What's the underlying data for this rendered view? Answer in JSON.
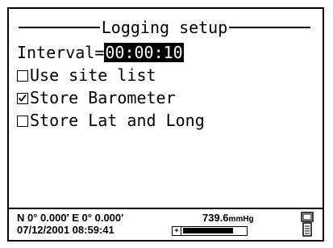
{
  "screen": {
    "title": "Logging setup",
    "interval_label": "Interval=",
    "interval_value": "00:00:10",
    "options": [
      {
        "label": "Use site list",
        "checked": false
      },
      {
        "label": "Store Barometer",
        "checked": true
      },
      {
        "label": "Store Lat and Long",
        "checked": false
      }
    ]
  },
  "status": {
    "coordinates": "N 0° 0.000' E  0° 0.000'",
    "datetime": "07/12/2001 08:59:41",
    "pressure_value": "739.6",
    "pressure_unit": "mmHg",
    "battery_level": 0.8
  }
}
